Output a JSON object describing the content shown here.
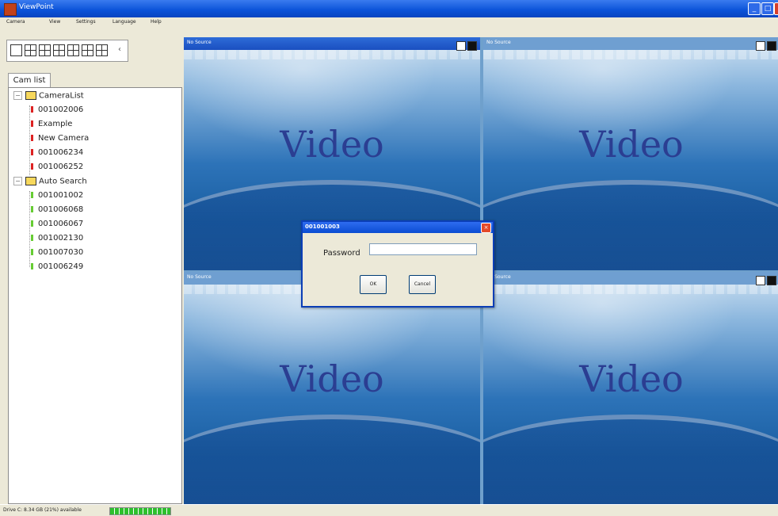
{
  "window": {
    "title": "ViewPoint"
  },
  "menu": [
    "Camera",
    "View",
    "Settings",
    "Language",
    "Help"
  ],
  "toolbar": {
    "speaker_glyph": "‹"
  },
  "tabs": {
    "cam_list": "Cam list"
  },
  "tree": {
    "root1": {
      "label": "CameraList",
      "items": [
        "001002006",
        "Example",
        "New Camera",
        "001006234",
        "001006252"
      ]
    },
    "root2": {
      "label": "Auto Search",
      "items": [
        "001001002",
        "001006068",
        "001006067",
        "001002130",
        "001007030",
        "001006249"
      ]
    }
  },
  "panes": [
    {
      "title": "No Source",
      "video": "Video",
      "active": true
    },
    {
      "title": "No Source",
      "video": "Video",
      "active": false
    },
    {
      "title": "No Source",
      "video": "Video",
      "active": false
    },
    {
      "title": "No Source",
      "video": "Video",
      "active": false
    }
  ],
  "dialog": {
    "title": "001001003",
    "password_label": "Password",
    "password_value": "",
    "ok": "OK",
    "cancel": "Cancel"
  },
  "status": {
    "drive_text": "Drive C: 8.34 GB (21%) available",
    "drive_fill_fraction": 1.0
  },
  "colors": {
    "titlebar": "#0A52D8",
    "cam_offline": "#DD2222",
    "cam_online": "#66CC33"
  }
}
